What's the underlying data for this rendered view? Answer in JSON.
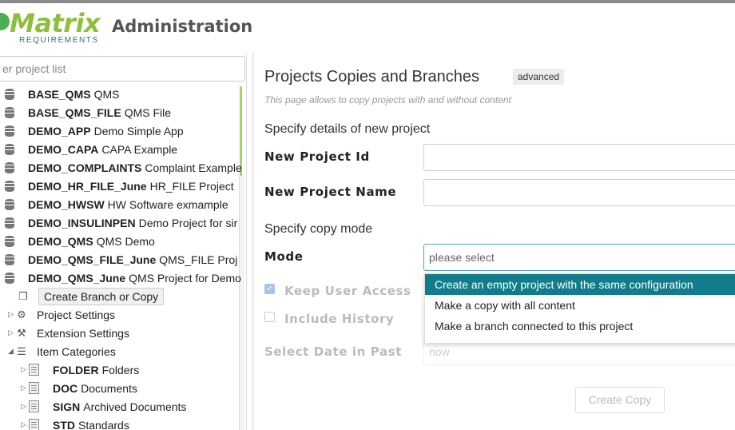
{
  "header": {
    "logo_text": "Matrix",
    "logo_sub": "REQUIREMENTS",
    "app_title": "Administration"
  },
  "sidebar": {
    "filter_placeholder": "er project list",
    "projects": [
      {
        "id": "BASE_QMS",
        "name": "QMS"
      },
      {
        "id": "BASE_QMS_FILE",
        "name": "QMS File"
      },
      {
        "id": "DEMO_APP",
        "name": "Demo Simple App"
      },
      {
        "id": "DEMO_CAPA",
        "name": "CAPA Example"
      },
      {
        "id": "DEMO_COMPLAINTS",
        "name": "Complaint Example"
      },
      {
        "id": "DEMO_HR_FILE_June",
        "name": "HR_FILE Project"
      },
      {
        "id": "DEMO_HWSW",
        "name": "HW Software exmample"
      },
      {
        "id": "DEMO_INSULINPEN",
        "name": "Demo Project for sir"
      },
      {
        "id": "DEMO_QMS",
        "name": "QMS Demo"
      },
      {
        "id": "DEMO_QMS_FILE_June",
        "name": "QMS_FILE Proj"
      },
      {
        "id": "DEMO_QMS_June",
        "name": "QMS Project for Demo"
      }
    ],
    "create_branch": "Create Branch or Copy",
    "project_settings": "Project Settings",
    "extension_settings": "Extension Settings",
    "item_categories": "Item Categories",
    "categories": [
      {
        "id": "FOLDER",
        "name": "Folders"
      },
      {
        "id": "DOC",
        "name": "Documents"
      },
      {
        "id": "SIGN",
        "name": "Archived Documents"
      },
      {
        "id": "STD",
        "name": "Standards"
      }
    ]
  },
  "main": {
    "title": "Projects Copies and Branches",
    "badge": "advanced",
    "subtitle": "This page allows to copy projects with and without content",
    "section_details": "Specify details of new project",
    "label_id": "New Project Id",
    "label_name": "New Project Name",
    "section_mode": "Specify copy mode",
    "label_mode": "Mode",
    "mode_placeholder": "please select",
    "mode_options": [
      "Create an empty project with the same configuration",
      "Make a copy with all content",
      "Make a branch connected to this project"
    ],
    "keep_user_access": "Keep User Access",
    "include_history": "Include History",
    "select_date_label": "Select Date in Past",
    "date_value": "now",
    "create_copy": "Create Copy"
  }
}
